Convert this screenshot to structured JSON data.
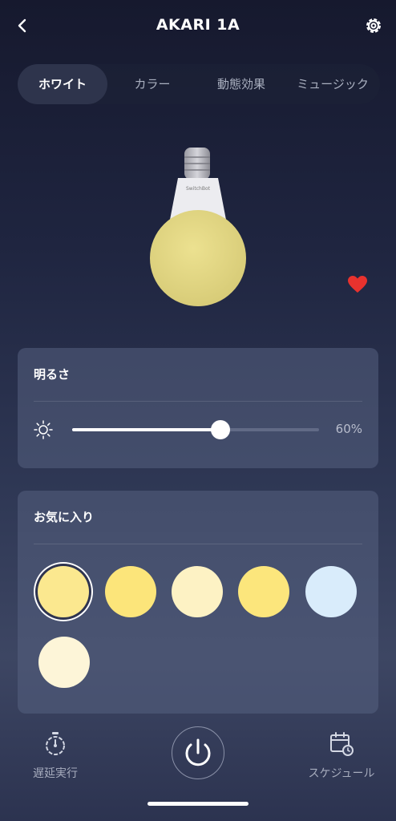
{
  "header": {
    "title": "AKARI 1A"
  },
  "tabs": [
    {
      "label": "ホワイト",
      "active": true
    },
    {
      "label": "カラー",
      "active": false
    },
    {
      "label": "動態効果",
      "active": false
    },
    {
      "label": "ミュージック",
      "active": false
    }
  ],
  "bulb": {
    "brand": "SwitchBot",
    "color": "#e5d98a"
  },
  "brightness": {
    "title": "明るさ",
    "value": "60%",
    "level": 0.6
  },
  "favorites": {
    "title": "お気に入り",
    "swatches": [
      {
        "color": "#fbe88f",
        "selected": true
      },
      {
        "color": "#fce57a",
        "selected": false
      },
      {
        "color": "#fdf2c4",
        "selected": false
      },
      {
        "color": "#fce67c",
        "selected": false
      },
      {
        "color": "#d9ecfb",
        "selected": false
      },
      {
        "color": "#fdf5d8",
        "selected": false
      }
    ]
  },
  "bottom": {
    "delay_label": "遅延実行",
    "schedule_label": "スケジュール"
  },
  "icons": [
    "back-icon",
    "gear-icon",
    "heart-icon",
    "sun-icon",
    "timer-icon",
    "power-icon",
    "calendar-icon"
  ],
  "colors": {
    "heart": "#e8322e",
    "accent": "#ffffff"
  }
}
